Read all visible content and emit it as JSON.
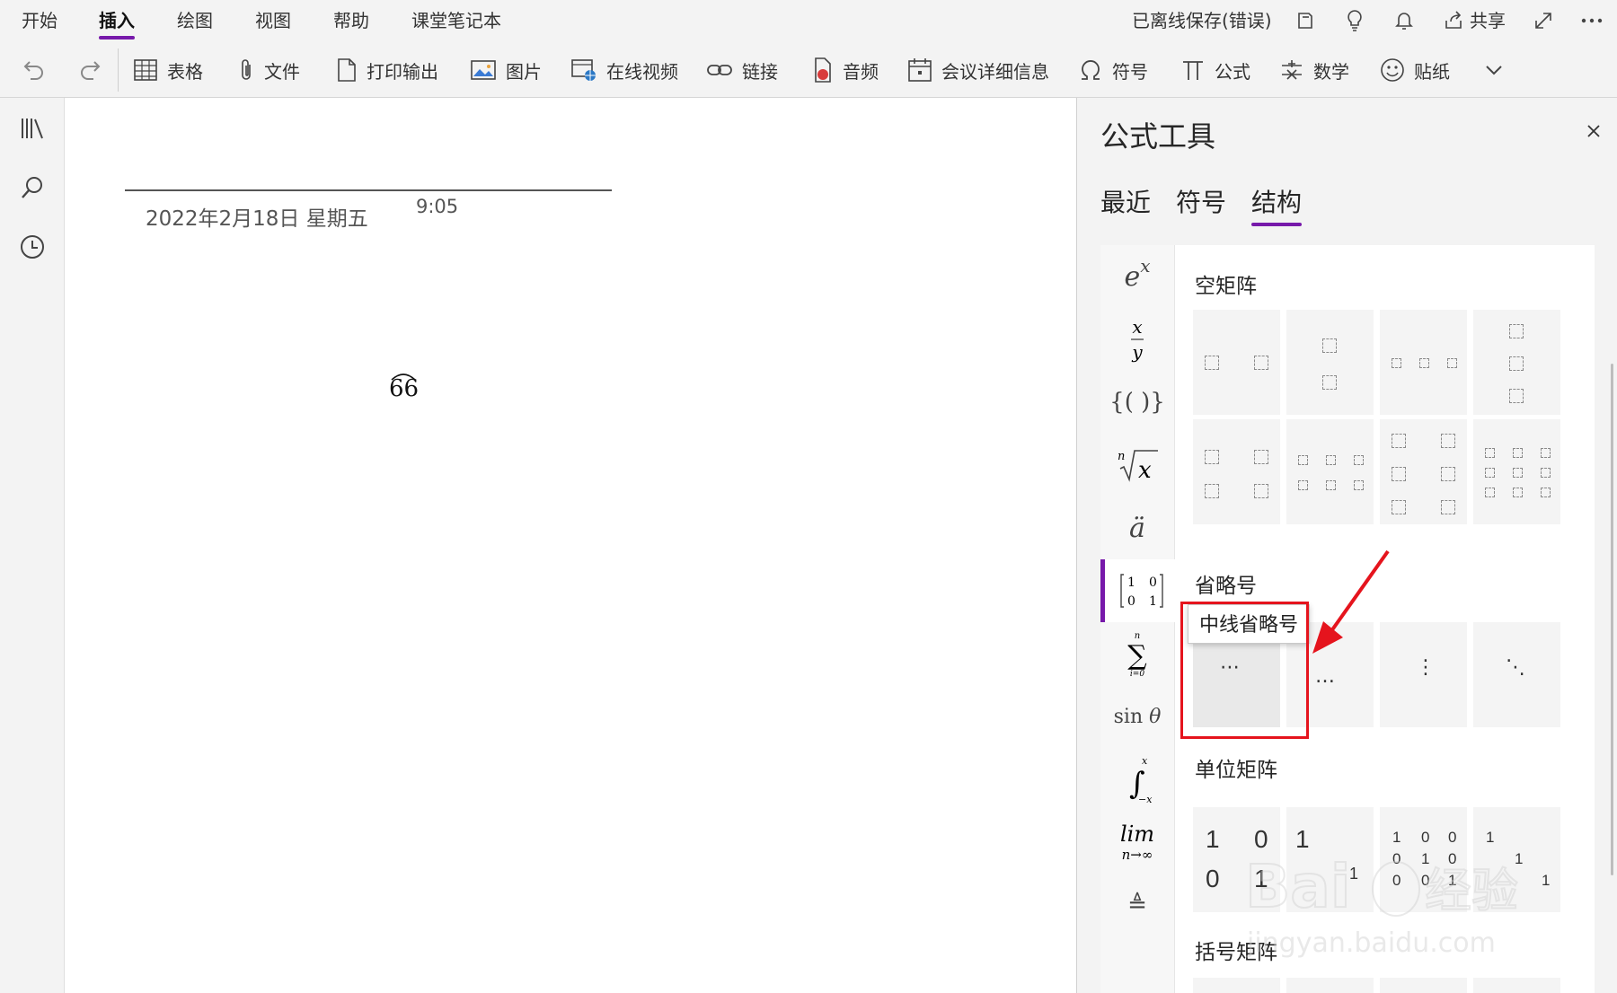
{
  "menu": {
    "tabs": [
      "开始",
      "插入",
      "绘图",
      "视图",
      "帮助",
      "课堂笔记本"
    ],
    "active_tab": "插入",
    "status": "已离线保存(错误)",
    "share_label": "共享"
  },
  "ribbon": {
    "table": "表格",
    "file": "文件",
    "printout": "打印输出",
    "picture": "图片",
    "online_video": "在线视频",
    "link": "链接",
    "audio": "音频",
    "meeting": "会议详细信息",
    "symbol": "符号",
    "equation": "公式",
    "math": "数学",
    "sticker": "贴纸"
  },
  "page": {
    "date": "2022年2月18日 星期五",
    "time": "9:05",
    "equation_text": "66"
  },
  "pane": {
    "title": "公式工具",
    "tabs": [
      "最近",
      "符号",
      "结构"
    ],
    "active_tab": "结构",
    "categories": [
      "e^x",
      "x/y",
      "{()}",
      "ⁿ√x",
      "ä",
      "matrix",
      "Σ",
      "sin θ",
      "∫",
      "lim",
      "≜"
    ],
    "active_category": "matrix",
    "sections": {
      "empty_matrix": "空矩阵",
      "ellipsis": "省略号",
      "identity_matrix": "单位矩阵",
      "bracket_matrix": "括号矩阵"
    },
    "tooltip": "中线省略号",
    "identity_tiles": {
      "t1": [
        "1",
        "0",
        "0",
        "1"
      ],
      "t2": [
        "1",
        "1"
      ],
      "t3": [
        "1",
        "0",
        "0",
        "0",
        "1",
        "0",
        "0",
        "0",
        "1"
      ],
      "t4": [
        "1",
        "1",
        "1"
      ]
    }
  },
  "colors": {
    "accent": "#7719aa",
    "highlight": "#e5141d",
    "background": "#f3f3f3"
  },
  "watermark": {
    "brand": "Bai du 经验",
    "url": "jingyan.baidu.com"
  }
}
